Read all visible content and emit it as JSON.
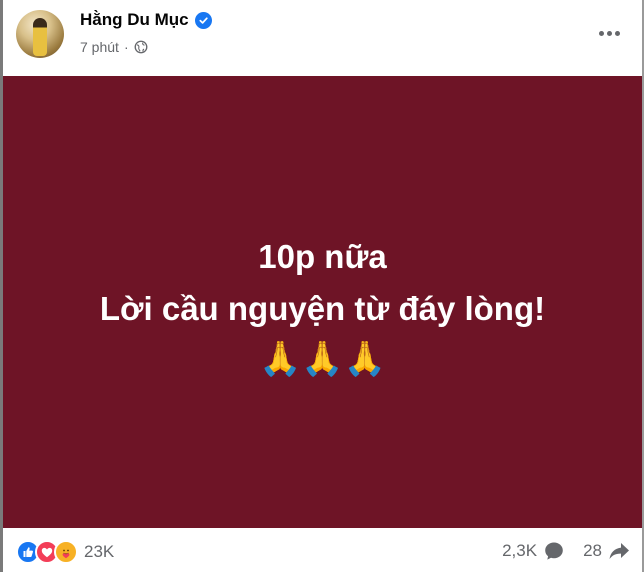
{
  "post": {
    "author_name": "Hằng Du Mục",
    "verified": true,
    "time": "7 phút",
    "privacy_icon": "globe-icon",
    "background_color": "#6e1426",
    "text_line1": "10p nữa",
    "text_line2": "Lời cầu nguyện từ đáy lòng!",
    "emoji_line": "🙏🙏🙏"
  },
  "engagement": {
    "reaction_icons": [
      "like-icon",
      "love-icon",
      "care-icon"
    ],
    "reaction_count": "23K",
    "comment_count": "2,3K",
    "share_count": "28"
  },
  "colors": {
    "accent": "#1877f2",
    "muted_text": "#65676b"
  }
}
